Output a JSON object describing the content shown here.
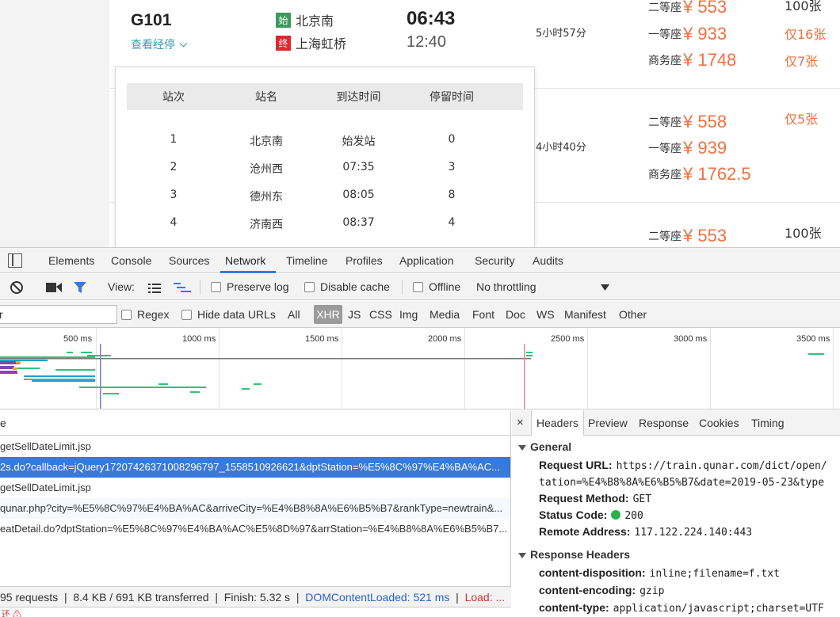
{
  "train": {
    "number": "G101",
    "stops_link": "查看经停",
    "start_badge": "始",
    "end_badge": "终",
    "from_station": "北京南",
    "to_station": "上海虹桥",
    "dep_time": "06:43",
    "arr_time": "12:40",
    "durations": [
      "5小时57分",
      "4小时40分"
    ]
  },
  "seats": [
    {
      "name": "二等座",
      "price": "¥ 553",
      "avail": "100张"
    },
    {
      "name": "一等座",
      "price": "¥ 933",
      "avail": "仅16张"
    },
    {
      "name": "商务座",
      "price": "¥ 1748",
      "avail": "仅7张"
    },
    {
      "name": "二等座",
      "price": "¥ 558",
      "avail": "仅5张"
    },
    {
      "name": "一等座",
      "price": "¥ 939",
      "avail": ""
    },
    {
      "name": "商务座",
      "price": "¥ 1762.5",
      "avail": ""
    },
    {
      "name": "二等座",
      "price": "¥ 553",
      "avail": "100张"
    }
  ],
  "stops_popup": {
    "headers": [
      "站次",
      "站名",
      "到达时间",
      "停留时间"
    ],
    "rows": [
      [
        "1",
        "北京南",
        "始发站",
        "0"
      ],
      [
        "2",
        "沧州西",
        "07:35",
        "3"
      ],
      [
        "3",
        "德州东",
        "08:05",
        "8"
      ],
      [
        "4",
        "济南西",
        "08:37",
        "4"
      ]
    ]
  },
  "devtools": {
    "tabs": [
      "Elements",
      "Console",
      "Sources",
      "Network",
      "Timeline",
      "Profiles",
      "Application",
      "Security",
      "Audits"
    ],
    "toolbar": {
      "view_label": "View:",
      "preserve_log": "Preserve log",
      "disable_cache": "Disable cache",
      "offline": "Offline",
      "throttling": "No throttling"
    },
    "filter": {
      "input_value": "r",
      "regex": "Regex",
      "hide_data_urls": "Hide data URLs",
      "types": [
        "All",
        "XHR",
        "JS",
        "CSS",
        "Img",
        "Media",
        "Font",
        "Doc",
        "WS",
        "Manifest",
        "Other"
      ]
    },
    "timeline_ticks": [
      "500 ms",
      "1000 ms",
      "1500 ms",
      "2000 ms",
      "2500 ms",
      "3000 ms",
      "3500 ms"
    ],
    "requests": {
      "header": "e",
      "rows": [
        "getSellDateLimit.jsp",
        "2s.do?callback=jQuery17207426371008296797_1558510926621&dptStation=%E5%8C%97%E4%BA%AC...",
        "getSellDateLimit.jsp",
        "qunar.php?city=%E5%8C%97%E4%BA%AC&arriveCity=%E4%B8%8A%E6%B5%B7&rankType=newtrain&...",
        "eatDetail.do?dptStation=%E5%8C%97%E4%BA%AC%E5%8D%97&arrStation=%E4%B8%8A%E6%B5%B7..."
      ]
    },
    "status": {
      "requests": "95 requests",
      "transferred": "8.4 KB / 691 KB transferred",
      "finish": "Finish: 5.32 s",
      "dom": "DOMContentLoaded: 521 ms",
      "load": "Load: ..."
    },
    "details": {
      "close": "×",
      "tabs": [
        "Headers",
        "Preview",
        "Response",
        "Cookies",
        "Timing"
      ],
      "general_title": "General",
      "request_url_key": "Request URL:",
      "request_url_val": "https://train.qunar.com/dict/open/",
      "request_url_cont": "tation=%E4%B8%8A%E6%B5%B7&date=2019-05-23&type",
      "method_key": "Request Method:",
      "method_val": "GET",
      "status_key": "Status Code:",
      "status_val": "200",
      "remote_key": "Remote Address:",
      "remote_val": "117.122.224.140:443",
      "response_title": "Response Headers",
      "cd_key": "content-disposition:",
      "cd_val": "inline;filename=f.txt",
      "ce_key": "content-encoding:",
      "ce_val": "gzip",
      "ct_key": "content-type:",
      "ct_val": "application/javascript;charset=UTF"
    },
    "console_strip": "还 ⚠"
  }
}
